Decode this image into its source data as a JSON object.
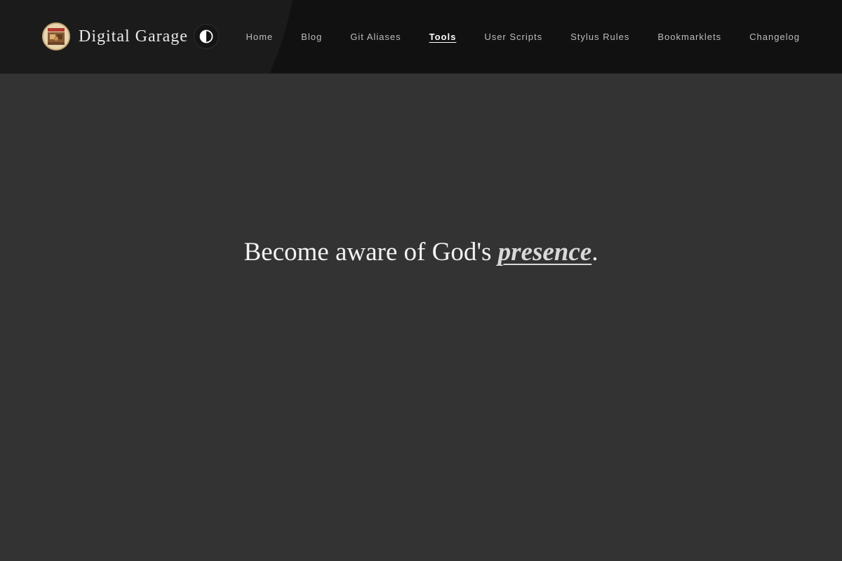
{
  "header": {
    "site_name": "Digital Garage",
    "logo_icon": "garage-logo",
    "theme_toggle_icon": "contrast-icon"
  },
  "nav": {
    "items": [
      {
        "label": "Home",
        "active": false
      },
      {
        "label": "Blog",
        "active": false
      },
      {
        "label": "Git Aliases",
        "active": false
      },
      {
        "label": "Tools",
        "active": true
      },
      {
        "label": "User Scripts",
        "active": false
      },
      {
        "label": "Stylus Rules",
        "active": false
      },
      {
        "label": "Bookmarklets",
        "active": false
      },
      {
        "label": "Changelog",
        "active": false
      }
    ]
  },
  "main": {
    "quote_prefix": "Become aware of God's ",
    "quote_emphasis": "presence",
    "quote_suffix": "."
  },
  "colors": {
    "header_bg": "#111111",
    "page_bg": "#333333",
    "text": "#f2f2f2"
  }
}
